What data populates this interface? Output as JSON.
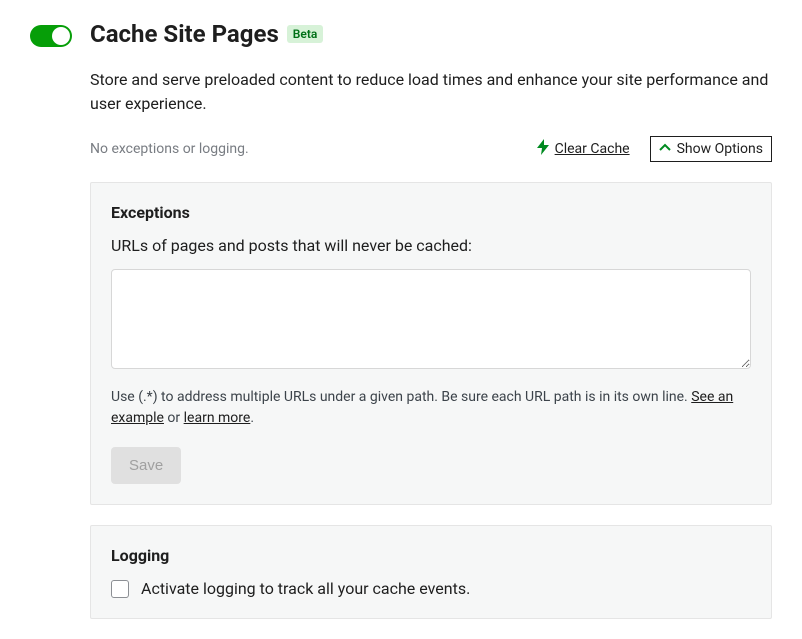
{
  "header": {
    "title": "Cache Site Pages",
    "badge": "Beta",
    "toggle_on": true
  },
  "description": "Store and serve preloaded content to reduce load times and enhance your site performance and user experience.",
  "status": {
    "text": "No exceptions or logging.",
    "clear_cache": "Clear Cache",
    "show_options": "Show Options"
  },
  "exceptions": {
    "title": "Exceptions",
    "label": "URLs of pages and posts that will never be cached:",
    "textarea_value": "",
    "hint_pre": "Use (.*) to address multiple URLs under a given path. Be sure each URL path is in its own line. ",
    "hint_see": "See an example",
    "hint_or": " or ",
    "hint_learn": "learn more",
    "hint_post": ".",
    "save_label": "Save"
  },
  "logging": {
    "title": "Logging",
    "checkbox_label": "Activate logging to track all your cache events.",
    "checked": false
  }
}
